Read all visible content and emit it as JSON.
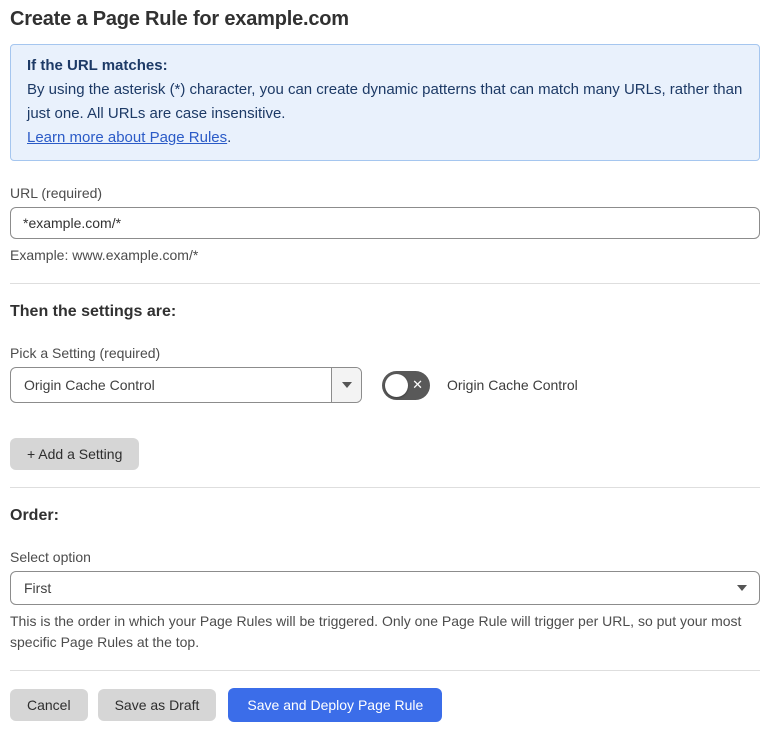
{
  "page": {
    "title": "Create a Page Rule for example.com"
  },
  "info_box": {
    "heading": "If the URL matches:",
    "body": "By using the asterisk (*) character, you can create dynamic patterns that can match many URLs, rather than just one. All URLs are case insensitive.",
    "link": "Learn more about Page Rules",
    "link_suffix": "."
  },
  "url_field": {
    "label": "URL (required)",
    "value": "*example.com/*",
    "helper": "Example: www.example.com/*"
  },
  "settings_section": {
    "heading": "Then the settings are:",
    "picker_label": "Pick a Setting (required)",
    "selected_setting": "Origin Cache Control",
    "toggle_state": "off",
    "toggle_glyph": "✕",
    "toggle_label": "Origin Cache Control",
    "add_button": "+ Add a Setting"
  },
  "order_section": {
    "heading": "Order:",
    "label": "Select option",
    "selected": "First",
    "helper": "This is the order in which your Page Rules will be triggered. Only one Page Rule will trigger per URL, so put your most specific Page Rules at the top."
  },
  "footer": {
    "cancel": "Cancel",
    "save_draft": "Save as Draft",
    "save_deploy": "Save and Deploy Page Rule"
  },
  "icons": {
    "picker_caret": "caret-down",
    "order_caret": "caret-down"
  },
  "colors": {
    "accent_blue": "#3b6de9",
    "info_bg": "#e9f1fc",
    "info_border": "#a5c6ef",
    "info_text": "#1d3a66",
    "link_blue": "#2b5bc7",
    "toggle_off_bg": "#595959",
    "button_gray": "#d6d6d6"
  }
}
